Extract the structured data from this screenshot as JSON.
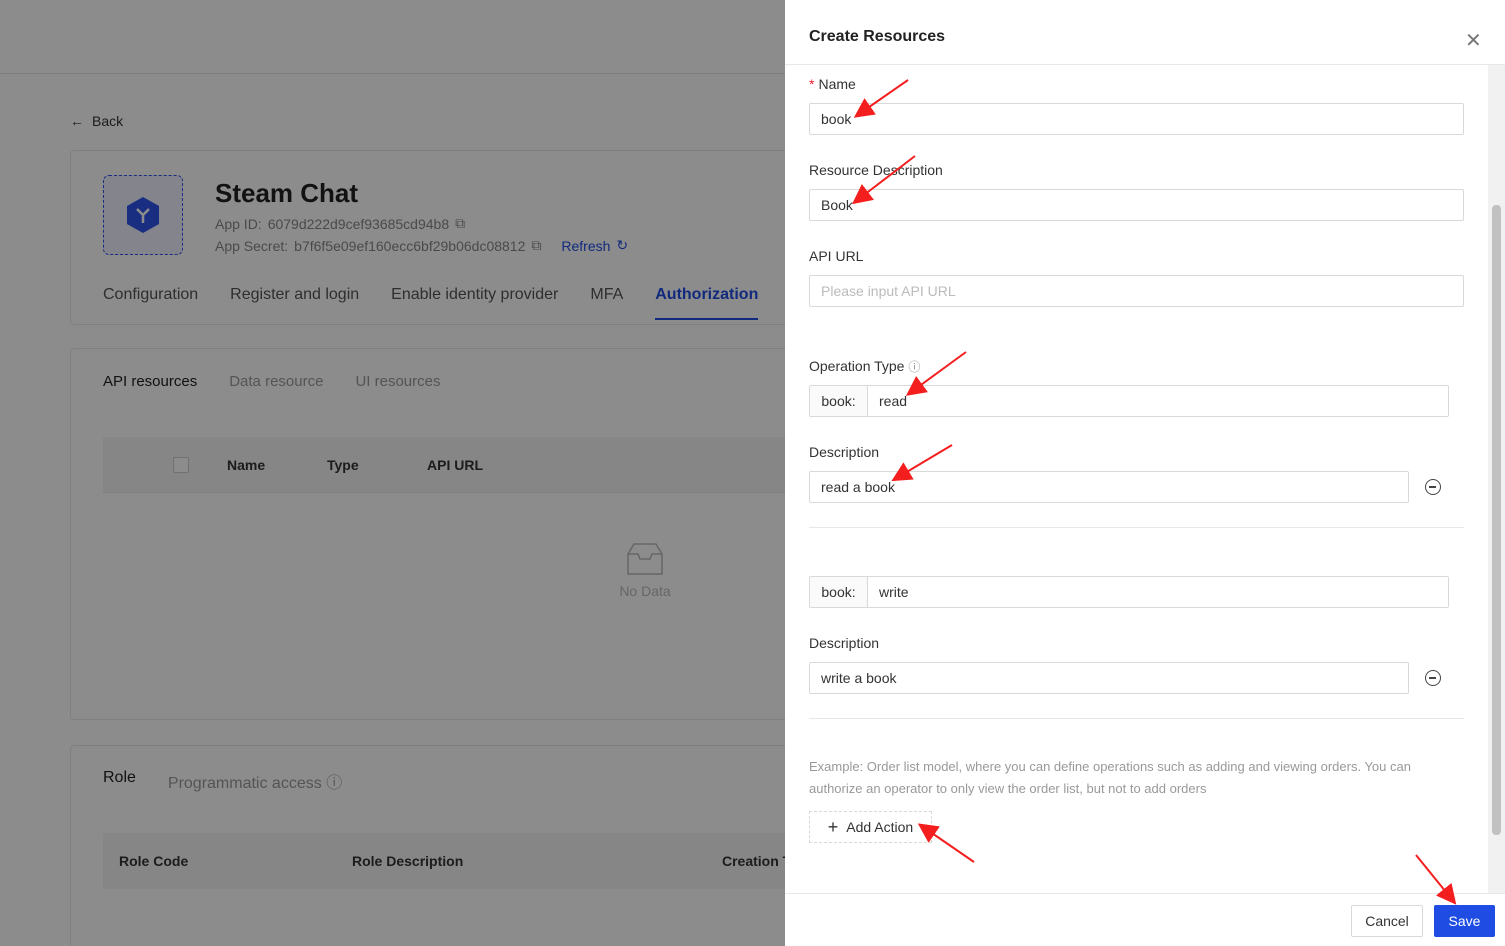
{
  "back": {
    "label": "Back"
  },
  "app": {
    "name": "Steam Chat",
    "id_label": "App ID:",
    "id_value": "6079d222d9cef93685cd94b8",
    "secret_label": "App Secret:",
    "secret_value": "b7f6f5e09ef160ecc6bf29b06dc08812",
    "refresh": "Refresh"
  },
  "tabs": [
    "Configuration",
    "Register and login",
    "Enable identity provider",
    "MFA",
    "Authorization"
  ],
  "subtabs": [
    "API resources",
    "Data resource",
    "UI resources"
  ],
  "table": {
    "headers": [
      "Name",
      "Type",
      "API URL"
    ],
    "empty": "No Data"
  },
  "role_tabs": [
    "Role",
    "Programmatic access"
  ],
  "role_table": {
    "headers": [
      "Role Code",
      "Role Description",
      "Creation T"
    ]
  },
  "drawer": {
    "title": "Create Resources",
    "name_label": "Name",
    "name_value": "book",
    "desc_label": "Resource Description",
    "desc_value": "Book",
    "api_label": "API URL",
    "api_placeholder": "Please input API URL",
    "op_label": "Operation Type",
    "actions": [
      {
        "prefix": "book:",
        "value": "read",
        "desc_label": "Description",
        "desc": "read a book"
      },
      {
        "prefix": "book:",
        "value": "write",
        "desc_label": "Description",
        "desc": "write a book"
      }
    ],
    "hint": "Example: Order list model, where you can define operations such as adding and viewing orders. You can authorize an operator to only view the order list, but not to add orders",
    "add_action": "Add Action",
    "cancel": "Cancel",
    "save": "Save"
  },
  "colors": {
    "accent": "#1f4de3",
    "annotation": "#f41e1e"
  }
}
